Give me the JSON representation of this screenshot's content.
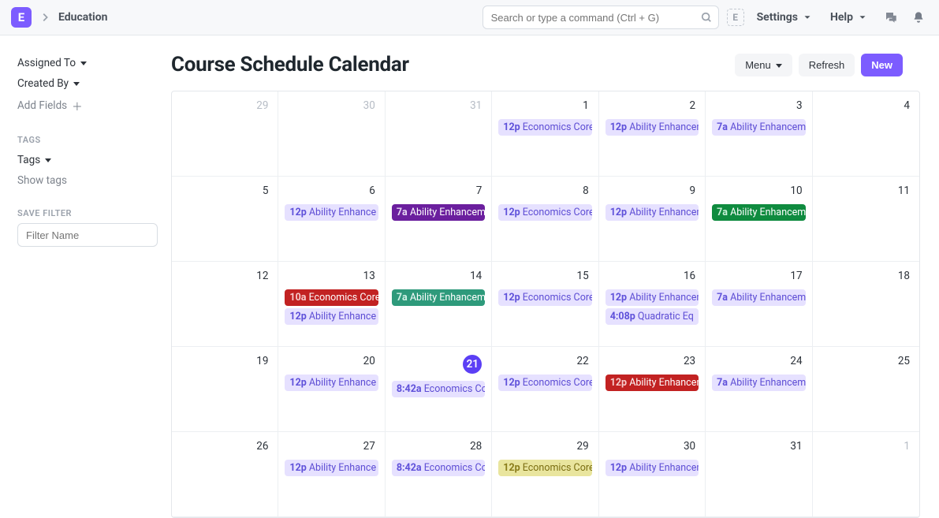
{
  "header": {
    "logo_letter": "E",
    "breadcrumb": "Education",
    "search_placeholder": "Search or type a command (Ctrl + G)",
    "workspace_letter": "E",
    "settings_label": "Settings",
    "help_label": "Help"
  },
  "page_title": "Course Schedule Calendar",
  "buttons": {
    "menu": "Menu",
    "refresh": "Refresh",
    "new": "New"
  },
  "sidebar": {
    "assigned_to": "Assigned To",
    "created_by": "Created By",
    "add_fields": "Add Fields",
    "tags_section": "TAGS",
    "tags": "Tags",
    "show_tags": "Show tags",
    "save_filter_section": "SAVE FILTER",
    "filter_placeholder": "Filter Name"
  },
  "calendar": {
    "weeks": [
      {
        "days": [
          {
            "num": "29",
            "muted": true,
            "events": []
          },
          {
            "num": "30",
            "muted": true,
            "events": []
          },
          {
            "num": "31",
            "muted": true,
            "events": []
          },
          {
            "num": "1",
            "events": [
              {
                "time": "12p",
                "title": "Economics Core",
                "color": "lav"
              }
            ]
          },
          {
            "num": "2",
            "events": [
              {
                "time": "12p",
                "title": "Ability Enhancem",
                "color": "lav"
              }
            ]
          },
          {
            "num": "3",
            "events": [
              {
                "time": "7a",
                "title": "Ability Enhancem",
                "color": "lav"
              }
            ]
          },
          {
            "num": "4",
            "events": []
          }
        ]
      },
      {
        "days": [
          {
            "num": "5",
            "events": []
          },
          {
            "num": "6",
            "events": [
              {
                "time": "12p",
                "title": "Ability Enhance",
                "color": "lav"
              }
            ]
          },
          {
            "num": "7",
            "events": [
              {
                "time": "7a",
                "title": "Ability Enhancem",
                "color": "purple"
              }
            ]
          },
          {
            "num": "8",
            "events": [
              {
                "time": "12p",
                "title": "Economics Core",
                "color": "lav"
              }
            ]
          },
          {
            "num": "9",
            "events": [
              {
                "time": "12p",
                "title": "Ability Enhancem",
                "color": "lav"
              }
            ]
          },
          {
            "num": "10",
            "events": [
              {
                "time": "7a",
                "title": "Ability Enhancem",
                "color": "green"
              }
            ]
          },
          {
            "num": "11",
            "events": []
          }
        ]
      },
      {
        "days": [
          {
            "num": "12",
            "events": []
          },
          {
            "num": "13",
            "events": [
              {
                "time": "10a",
                "title": "Economics Core",
                "color": "red"
              },
              {
                "time": "12p",
                "title": "Ability Enhance",
                "color": "lav"
              }
            ]
          },
          {
            "num": "14",
            "events": [
              {
                "time": "7a",
                "title": "Ability Enhancem",
                "color": "teal"
              }
            ]
          },
          {
            "num": "15",
            "events": [
              {
                "time": "12p",
                "title": "Economics Core",
                "color": "lav"
              }
            ]
          },
          {
            "num": "16",
            "events": [
              {
                "time": "12p",
                "title": "Ability Enhancem",
                "color": "lav"
              },
              {
                "time": "4:08p",
                "title": "Quadratic Eq",
                "color": "lav"
              }
            ]
          },
          {
            "num": "17",
            "events": [
              {
                "time": "7a",
                "title": "Ability Enhancem",
                "color": "lav"
              }
            ]
          },
          {
            "num": "18",
            "events": []
          }
        ]
      },
      {
        "days": [
          {
            "num": "19",
            "events": []
          },
          {
            "num": "20",
            "events": [
              {
                "time": "12p",
                "title": "Ability Enhance",
                "color": "lav"
              }
            ]
          },
          {
            "num": "21",
            "today": true,
            "events": [
              {
                "time": "8:42a",
                "title": "Economics Co",
                "color": "lav"
              }
            ]
          },
          {
            "num": "22",
            "events": [
              {
                "time": "12p",
                "title": "Economics Core",
                "color": "lav"
              }
            ]
          },
          {
            "num": "23",
            "events": [
              {
                "time": "12p",
                "title": "Ability Enhancem",
                "color": "red"
              }
            ]
          },
          {
            "num": "24",
            "events": [
              {
                "time": "7a",
                "title": "Ability Enhancem",
                "color": "lav"
              }
            ]
          },
          {
            "num": "25",
            "events": []
          }
        ]
      },
      {
        "days": [
          {
            "num": "26",
            "events": []
          },
          {
            "num": "27",
            "events": [
              {
                "time": "12p",
                "title": "Ability Enhance",
                "color": "lav"
              }
            ]
          },
          {
            "num": "28",
            "events": [
              {
                "time": "8:42a",
                "title": "Economics Co",
                "color": "lav"
              }
            ]
          },
          {
            "num": "29",
            "events": [
              {
                "time": "12p",
                "title": "Economics Core",
                "color": "olive"
              }
            ]
          },
          {
            "num": "30",
            "events": [
              {
                "time": "12p",
                "title": "Ability Enhancem",
                "color": "lav"
              }
            ]
          },
          {
            "num": "31",
            "events": []
          },
          {
            "num": "1",
            "muted": true,
            "events": []
          }
        ]
      }
    ]
  }
}
